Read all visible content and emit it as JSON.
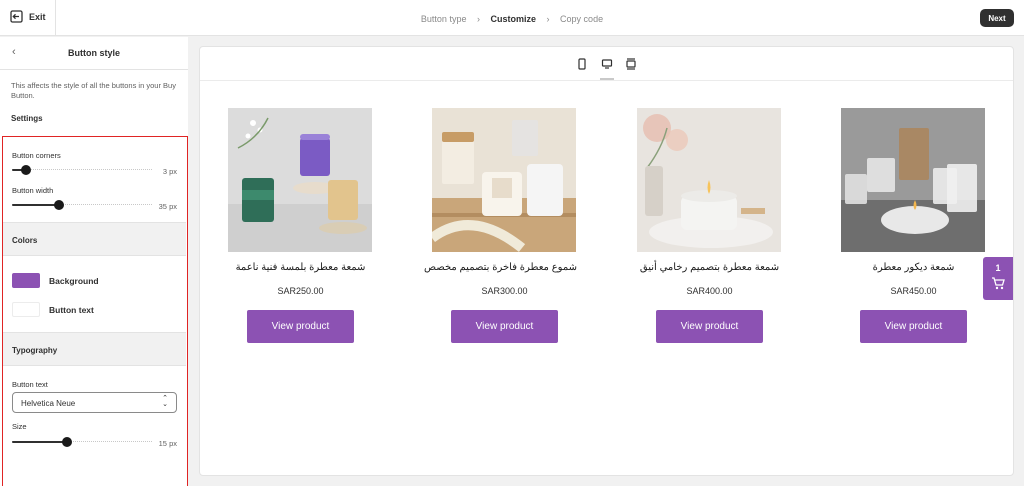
{
  "topbar": {
    "exit_label": "Exit",
    "steps": [
      "Button type",
      "Customize",
      "Copy code"
    ],
    "active_step": "Customize",
    "next_label": "Next"
  },
  "sidebar": {
    "back_icon": "chevron-left-icon",
    "title": "Button style",
    "description": "This affects the style of all the buttons in your Buy Button.",
    "settings_heading": "Settings",
    "button_corners": {
      "label": "Button corners",
      "value_text": "3 px",
      "value": 3
    },
    "button_width": {
      "label": "Button width",
      "value_text": "35 px",
      "value": 35
    },
    "colors_heading": "Colors",
    "background": {
      "label": "Background",
      "color": "#8c52b3"
    },
    "button_text_color": {
      "label": "Button text",
      "color": "#ffffff"
    },
    "typography_heading": "Typography",
    "font": {
      "label": "Button text",
      "value": "Helvetica Neue"
    },
    "size": {
      "label": "Size",
      "value_text": "15 px",
      "value": 15
    }
  },
  "preview": {
    "device_icons": [
      "mobile-icon",
      "desktop-icon",
      "fullwidth-icon"
    ],
    "active_device": "desktop-icon",
    "products": [
      {
        "title": "شمعة معطرة بلمسة فنية ناعمة",
        "price": "SAR250.00",
        "button": "View product"
      },
      {
        "title": "شموع معطرة فاخرة بتصميم مخصص",
        "price": "SAR300.00",
        "button": "View product"
      },
      {
        "title": "شمعة معطرة بتصميم رخامي أنيق",
        "price": "SAR400.00",
        "button": "View product"
      },
      {
        "title": "شمعة ديكور معطرة",
        "price": "SAR450.00",
        "button": "View product"
      }
    ]
  },
  "cart": {
    "count": "1",
    "icon": "cart-icon"
  },
  "colors": {
    "accent": "#8c52b3",
    "highlight_border": "#e02424",
    "dark": "#303030"
  }
}
